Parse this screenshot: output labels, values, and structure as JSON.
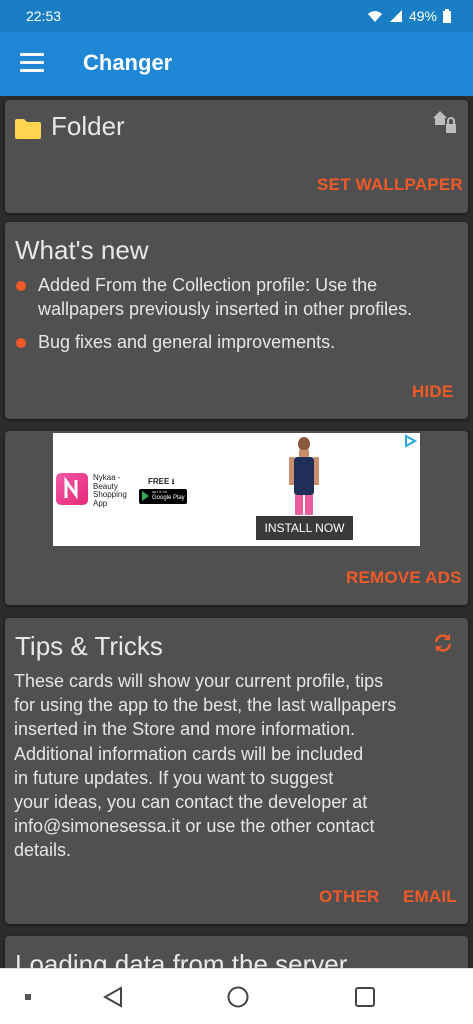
{
  "status": {
    "time": "22:53",
    "battery": "49%"
  },
  "appbar": {
    "title": "Changer"
  },
  "folder_card": {
    "title": "Folder",
    "action": "SET WALLPAPER"
  },
  "whats_new_card": {
    "title": "What's new",
    "items": [
      "Added From the Collection profile: Use the wallpapers previously inserted in other profiles.",
      "Bug fixes and general improvements."
    ],
    "action": "HIDE"
  },
  "ad_card": {
    "ad": {
      "brand_lines": [
        "Nykaa -",
        "Beauty",
        "Shopping",
        "App"
      ],
      "free_label": "FREE",
      "store_small": "GET IT ON",
      "store_name": "Google Play",
      "install_label": "INSTALL NOW"
    },
    "action": "REMOVE ADS"
  },
  "tips_card": {
    "title": "Tips & Tricks",
    "body_lines": [
      "These cards will show your current profile, tips",
      "for using the app to the best, the last wallpapers",
      "inserted in the Store and more information.",
      "Additional information cards will be included",
      "in future updates. If you want to suggest",
      "your ideas, you can contact the developer at",
      "info@simonesessa.it or use the other contact",
      "details."
    ],
    "action_other": "OTHER",
    "action_email": "EMAIL"
  },
  "loading_card": {
    "title": "Loading data from the server"
  },
  "colors": {
    "accent": "#f05a28",
    "primary": "#1e88d6",
    "card": "#505050"
  }
}
